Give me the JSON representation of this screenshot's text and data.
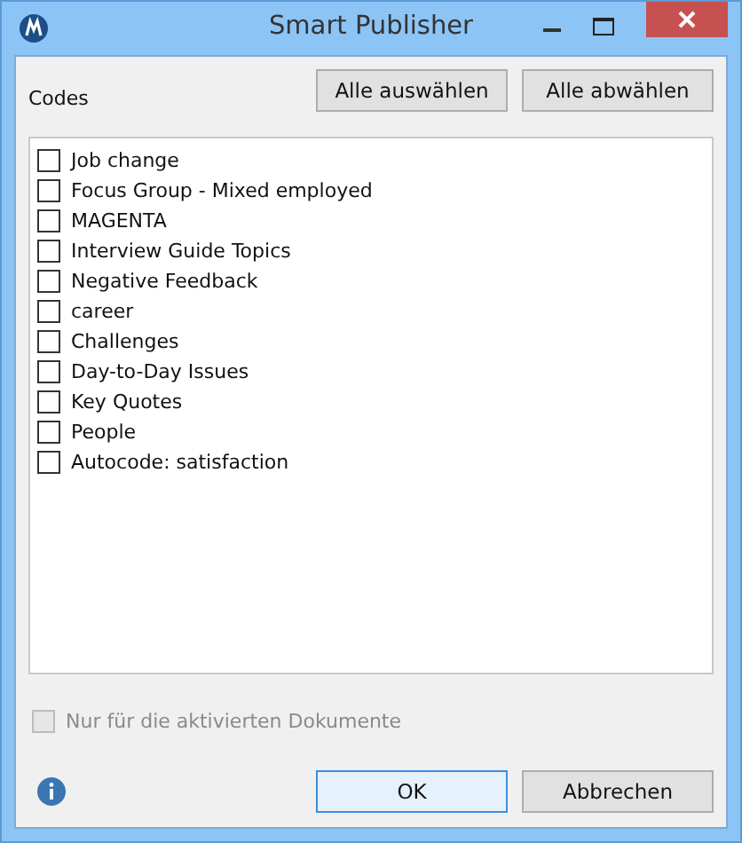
{
  "window": {
    "title": "Smart Publisher"
  },
  "header": {
    "label": "Codes",
    "buttons": [
      "Alle auswählen",
      "Alle abwählen"
    ]
  },
  "codes": [
    {
      "label": "Job change",
      "checked": false
    },
    {
      "label": "Focus Group - Mixed employed",
      "checked": false
    },
    {
      "label": "MAGENTA",
      "checked": false
    },
    {
      "label": "Interview Guide Topics",
      "checked": false
    },
    {
      "label": "Negative Feedback",
      "checked": false
    },
    {
      "label": "career",
      "checked": false
    },
    {
      "label": "Challenges",
      "checked": false
    },
    {
      "label": "Day-to-Day Issues",
      "checked": false
    },
    {
      "label": "Key Quotes",
      "checked": false
    },
    {
      "label": "People",
      "checked": false
    },
    {
      "label": "Autocode: satisfaction",
      "checked": false
    }
  ],
  "option": {
    "label": "Nur für die aktivierten Dokumente",
    "checked": false,
    "disabled": true
  },
  "footer": {
    "buttons": [
      {
        "label": "OK",
        "default": true
      },
      {
        "label": "Abbrechen",
        "default": false
      }
    ]
  }
}
